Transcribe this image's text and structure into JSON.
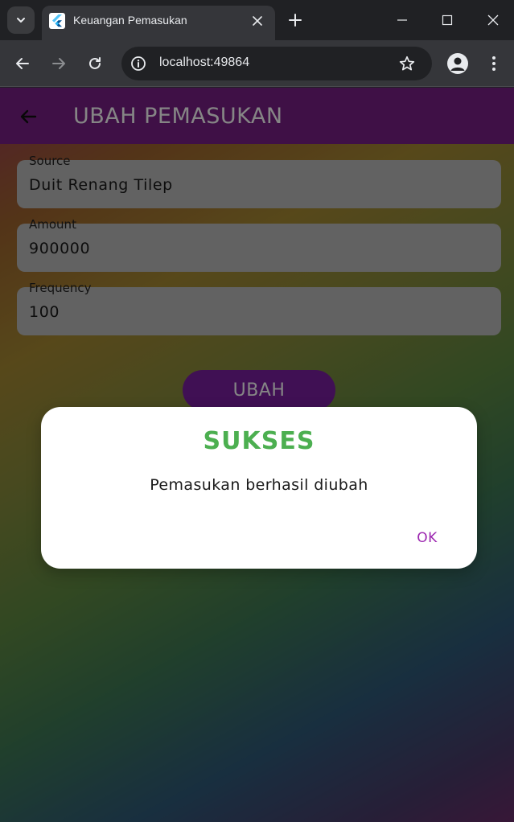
{
  "browser": {
    "tab_title": "Keuangan Pemasukan",
    "url": "localhost:49864",
    "colors": {
      "chrome_bg": "#202124",
      "toolbar_bg": "#35363a",
      "text": "#e8eaed"
    }
  },
  "app": {
    "title": "UBAH PEMASUKAN",
    "colors": {
      "app_bar": "#7a1f86",
      "button": "#7b1fa2",
      "field_bg": "#bdbdbd"
    },
    "fields": [
      {
        "label": "Source",
        "value": "Duit Renang Tilep"
      },
      {
        "label": "Amount",
        "value": "900000"
      },
      {
        "label": "Frequency",
        "value": "100"
      }
    ],
    "submit_label": "UBAH"
  },
  "dialog": {
    "title": "SUKSES",
    "message": "Pemasukan berhasil diubah",
    "ok_label": "OK",
    "colors": {
      "title": "#4caf50",
      "ok": "#9c27b0"
    }
  },
  "icons": {
    "tab_search": "chevron-down-icon",
    "favicon": "flutter-logo-icon",
    "tab_close": "close-icon",
    "new_tab": "plus-icon",
    "minimize": "minimize-icon",
    "maximize": "maximize-icon",
    "window_close": "close-icon",
    "back": "arrow-left-icon",
    "forward": "arrow-right-icon",
    "reload": "reload-icon",
    "site_info": "info-icon",
    "bookmark": "star-icon",
    "profile": "person-icon",
    "menu": "kebab-menu-icon",
    "app_back": "arrow-left-icon"
  }
}
